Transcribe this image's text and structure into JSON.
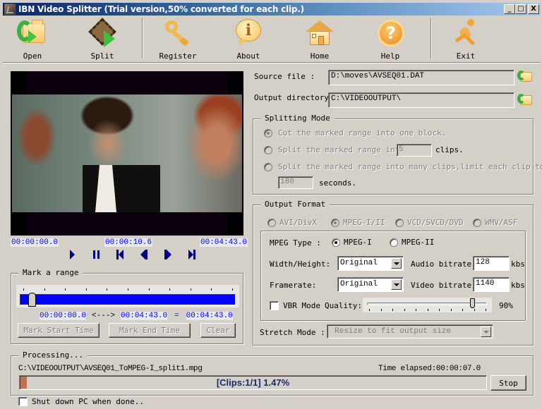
{
  "window": {
    "title": "IBN Video Splitter (Trial version,50% converted for each clip.)",
    "controls": {
      "minimize": "_",
      "maximize": "□",
      "close": "X"
    }
  },
  "toolbar": {
    "open": "Open",
    "split": "Split",
    "register": "Register",
    "about": "About",
    "home": "Home",
    "help": "Help",
    "exit": "Exit"
  },
  "player": {
    "time_start": "00:00:00.0",
    "time_current": "00:00:10.6",
    "time_end": "00:04:43.0",
    "controls": [
      "play",
      "pause",
      "first-frame",
      "previous-frame",
      "next-frame",
      "last-frame"
    ]
  },
  "mark_range": {
    "title": "Mark a range",
    "start_time": "00:00:00.0",
    "arrow": "<--->",
    "end_time": "00:04:43.0",
    "equals": "=",
    "duration": "00:04:43.0",
    "mark_start_label": "Mark Start Time",
    "mark_end_label": "Mark End Time",
    "clear_label": "Clear",
    "thumb_position_fraction": 0.04
  },
  "source": {
    "source_label": "Source file :",
    "source_value": "D:\\moves\\AVSEQ01.DAT",
    "output_label": "Output directory:",
    "output_value": "C:\\VIDEOOUTPUT\\"
  },
  "splitting_mode": {
    "title": "Splitting Mode",
    "option1": "Cut the marked range into one block.",
    "option2": "Split the marked range into",
    "option2_value": "5",
    "option2_suffix": "clips.",
    "option3": "Split the marked range into many clips,limit each clip to",
    "option3_value": "180",
    "option3_suffix": "seconds.",
    "selected": 1
  },
  "output_format": {
    "title": "Output Format",
    "formats": [
      "AVI/DivX",
      "MPEG-I/II",
      "VCD/SVCD/DVD",
      "WMV/ASF"
    ],
    "selected_format": "MPEG-I/II",
    "mpeg_type_label": "MPEG Type :",
    "mpeg_types": [
      "MPEG-I",
      "MPEG-II"
    ],
    "selected_mpeg_type": "MPEG-I",
    "width_height_label": "Width/Height:",
    "width_height_value": "Original",
    "framerate_label": "Framerate:",
    "framerate_value": "Original",
    "audio_bitrate_label": "Audio bitrate:",
    "audio_bitrate_value": "128",
    "video_bitrate_label": "Video bitrate:",
    "video_bitrate_value": "1140",
    "kbs": "kbs",
    "vbr_label": "VBR Mode",
    "vbr_checked": false,
    "quality_label": "Quality:",
    "quality_value": "90%",
    "quality_fraction": 0.9,
    "stretch_label": "Stretch Mode :",
    "stretch_value": "Resize to fit output size"
  },
  "processing": {
    "title": "Processing...",
    "file": "C:\\VIDEOOUTPUT\\AVSEQ01_ToMPEG-I_split1.mpg",
    "time_elapsed": "Time elapsed:00:00:07.0",
    "progress_text": "[Clips:1/1]  1.47%",
    "progress_fraction": 0.0147,
    "stop_label": "Stop",
    "shutdown_label": "Shut down PC when done..",
    "shutdown_checked": false
  },
  "colors": {
    "timecode": "#0000ff",
    "range_track": "#0000ff",
    "progress_fill": "#c8704a",
    "progress_text": "#1a2a6a"
  }
}
